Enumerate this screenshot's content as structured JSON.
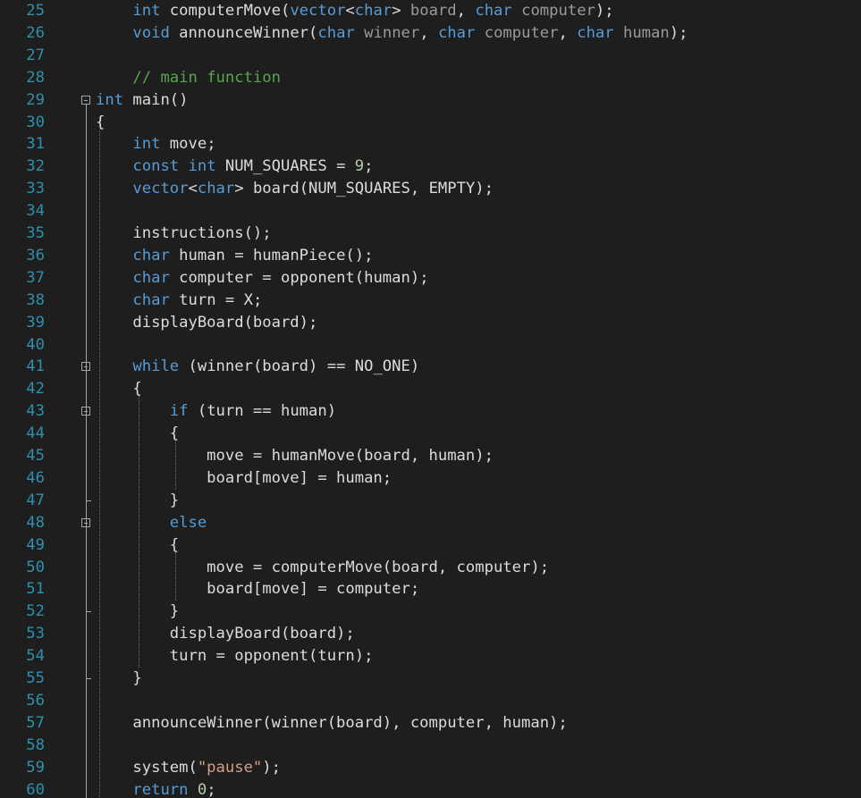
{
  "editor": {
    "colors": {
      "background": "#1e1e1e",
      "line_number": "#2b91af",
      "keyword": "#569cd6",
      "plain": "#dcdcdc",
      "parameter": "#9a9a9a",
      "comment": "#57a64a",
      "string": "#d69d85",
      "number": "#b5cea8",
      "fold_box": "#a5a5a5",
      "guide_line": "#a5a5a5"
    },
    "lines": [
      {
        "number": "25",
        "fold": false,
        "tokens": [
          [
            "    ",
            "plain"
          ],
          [
            "int",
            "kw"
          ],
          [
            " computerMove(",
            "plain"
          ],
          [
            "vector",
            "kw"
          ],
          [
            "<",
            "plain"
          ],
          [
            "char",
            "kw"
          ],
          [
            "> ",
            "plain"
          ],
          [
            "board",
            "param"
          ],
          [
            ", ",
            "plain"
          ],
          [
            "char",
            "kw"
          ],
          [
            " ",
            "plain"
          ],
          [
            "computer",
            "param"
          ],
          [
            ");",
            "plain"
          ]
        ]
      },
      {
        "number": "26",
        "fold": false,
        "tokens": [
          [
            "    ",
            "plain"
          ],
          [
            "void",
            "kw"
          ],
          [
            " announceWinner(",
            "plain"
          ],
          [
            "char",
            "kw"
          ],
          [
            " ",
            "plain"
          ],
          [
            "winner",
            "param"
          ],
          [
            ", ",
            "plain"
          ],
          [
            "char",
            "kw"
          ],
          [
            " ",
            "plain"
          ],
          [
            "computer",
            "param"
          ],
          [
            ", ",
            "plain"
          ],
          [
            "char",
            "kw"
          ],
          [
            " ",
            "plain"
          ],
          [
            "human",
            "param"
          ],
          [
            ");",
            "plain"
          ]
        ]
      },
      {
        "number": "27",
        "fold": false,
        "tokens": []
      },
      {
        "number": "28",
        "fold": false,
        "tokens": [
          [
            "    ",
            "plain"
          ],
          [
            "// main function",
            "comment"
          ]
        ]
      },
      {
        "number": "29",
        "fold": true,
        "tokens": [
          [
            "int",
            "kw"
          ],
          [
            " main()",
            "plain"
          ]
        ]
      },
      {
        "number": "30",
        "fold": false,
        "tokens": [
          [
            "{",
            "plain"
          ]
        ]
      },
      {
        "number": "31",
        "fold": false,
        "tokens": [
          [
            "    ",
            "plain"
          ],
          [
            "int",
            "kw"
          ],
          [
            " move;",
            "plain"
          ]
        ]
      },
      {
        "number": "32",
        "fold": false,
        "tokens": [
          [
            "    ",
            "plain"
          ],
          [
            "const",
            "kw"
          ],
          [
            " ",
            "plain"
          ],
          [
            "int",
            "kw"
          ],
          [
            " NUM_SQUARES = ",
            "plain"
          ],
          [
            "9",
            "number"
          ],
          [
            ";",
            "plain"
          ]
        ]
      },
      {
        "number": "33",
        "fold": false,
        "tokens": [
          [
            "    ",
            "plain"
          ],
          [
            "vector",
            "kw"
          ],
          [
            "<",
            "plain"
          ],
          [
            "char",
            "kw"
          ],
          [
            "> board(NUM_SQUARES, EMPTY);",
            "plain"
          ]
        ]
      },
      {
        "number": "34",
        "fold": false,
        "tokens": []
      },
      {
        "number": "35",
        "fold": false,
        "tokens": [
          [
            "    instructions();",
            "plain"
          ]
        ]
      },
      {
        "number": "36",
        "fold": false,
        "tokens": [
          [
            "    ",
            "plain"
          ],
          [
            "char",
            "kw"
          ],
          [
            " human = humanPiece();",
            "plain"
          ]
        ]
      },
      {
        "number": "37",
        "fold": false,
        "tokens": [
          [
            "    ",
            "plain"
          ],
          [
            "char",
            "kw"
          ],
          [
            " computer = opponent(human);",
            "plain"
          ]
        ]
      },
      {
        "number": "38",
        "fold": false,
        "tokens": [
          [
            "    ",
            "plain"
          ],
          [
            "char",
            "kw"
          ],
          [
            " turn = X;",
            "plain"
          ]
        ]
      },
      {
        "number": "39",
        "fold": false,
        "tokens": [
          [
            "    displayBoard(board);",
            "plain"
          ]
        ]
      },
      {
        "number": "40",
        "fold": false,
        "tokens": []
      },
      {
        "number": "41",
        "fold": true,
        "tokens": [
          [
            "    ",
            "plain"
          ],
          [
            "while",
            "kw"
          ],
          [
            " (winner(board) == NO_ONE)",
            "plain"
          ]
        ]
      },
      {
        "number": "42",
        "fold": false,
        "tokens": [
          [
            "    {",
            "plain"
          ]
        ]
      },
      {
        "number": "43",
        "fold": true,
        "tokens": [
          [
            "        ",
            "plain"
          ],
          [
            "if",
            "kw"
          ],
          [
            " (turn == human)",
            "plain"
          ]
        ]
      },
      {
        "number": "44",
        "fold": false,
        "tokens": [
          [
            "        {",
            "plain"
          ]
        ]
      },
      {
        "number": "45",
        "fold": false,
        "tokens": [
          [
            "            move = humanMove(board, human);",
            "plain"
          ]
        ]
      },
      {
        "number": "46",
        "fold": false,
        "tokens": [
          [
            "            board[move] = human;",
            "plain"
          ]
        ]
      },
      {
        "number": "47",
        "fold": false,
        "tokens": [
          [
            "        }",
            "plain"
          ]
        ]
      },
      {
        "number": "48",
        "fold": true,
        "tokens": [
          [
            "        ",
            "plain"
          ],
          [
            "else",
            "kw"
          ]
        ]
      },
      {
        "number": "49",
        "fold": false,
        "tokens": [
          [
            "        {",
            "plain"
          ]
        ]
      },
      {
        "number": "50",
        "fold": false,
        "tokens": [
          [
            "            move = computerMove(board, computer);",
            "plain"
          ]
        ]
      },
      {
        "number": "51",
        "fold": false,
        "tokens": [
          [
            "            board[move] = computer;",
            "plain"
          ]
        ]
      },
      {
        "number": "52",
        "fold": false,
        "tokens": [
          [
            "        }",
            "plain"
          ]
        ]
      },
      {
        "number": "53",
        "fold": false,
        "tokens": [
          [
            "        displayBoard(board);",
            "plain"
          ]
        ]
      },
      {
        "number": "54",
        "fold": false,
        "tokens": [
          [
            "        turn = opponent(turn);",
            "plain"
          ]
        ]
      },
      {
        "number": "55",
        "fold": false,
        "tokens": [
          [
            "    }",
            "plain"
          ]
        ]
      },
      {
        "number": "56",
        "fold": false,
        "tokens": []
      },
      {
        "number": "57",
        "fold": false,
        "tokens": [
          [
            "    announceWinner(winner(board), computer, human);",
            "plain"
          ]
        ]
      },
      {
        "number": "58",
        "fold": false,
        "tokens": []
      },
      {
        "number": "59",
        "fold": false,
        "tokens": [
          [
            "    system(",
            "plain"
          ],
          [
            "\"pause\"",
            "string"
          ],
          [
            ");",
            "plain"
          ]
        ]
      },
      {
        "number": "60",
        "fold": false,
        "tokens": [
          [
            "    ",
            "plain"
          ],
          [
            "return",
            "kw"
          ],
          [
            " ",
            "plain"
          ],
          [
            "0",
            "number"
          ],
          [
            ";",
            "plain"
          ]
        ]
      }
    ]
  }
}
